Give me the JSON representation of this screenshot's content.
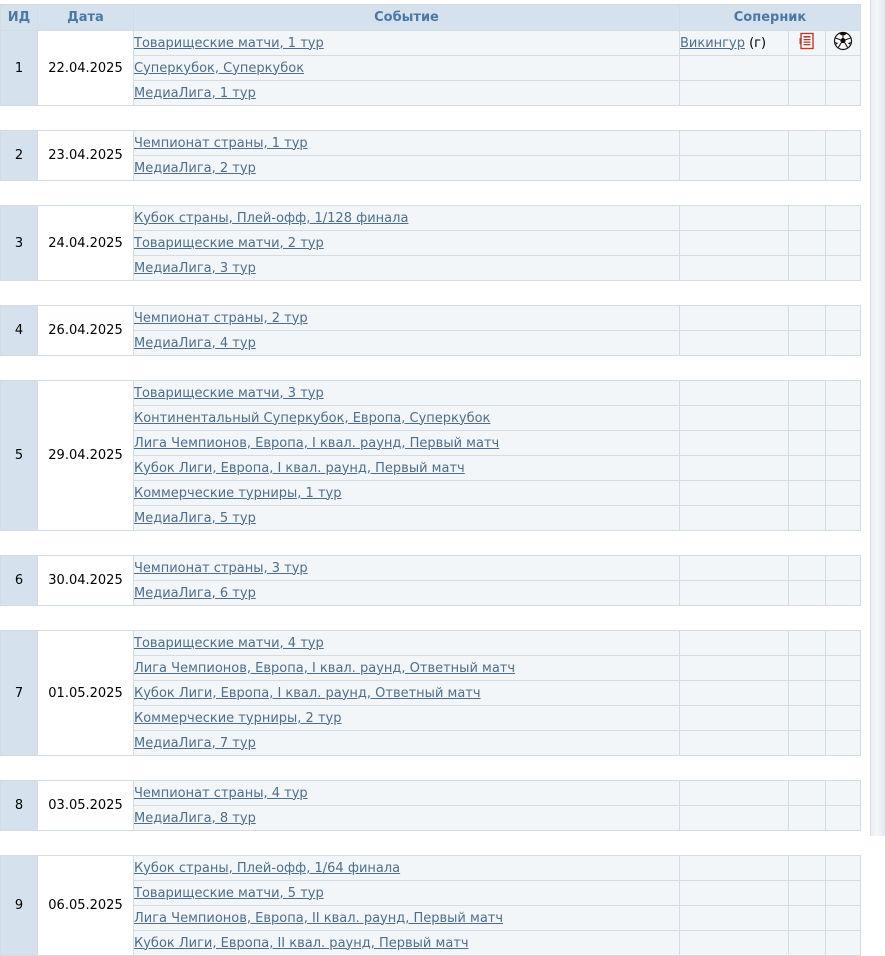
{
  "headers": {
    "id": "ИД",
    "date": "Дата",
    "event": "Событие",
    "opponent": "Соперник"
  },
  "days": [
    {
      "id": "1",
      "date": "22.04.2025",
      "events": [
        {
          "name": "Товарищеские матчи, 1 тур",
          "opponent": "Викингур",
          "venue": "(г)",
          "icons": [
            "report-icon",
            "ball-icon"
          ]
        },
        {
          "name": "Суперкубок, Суперкубок"
        },
        {
          "name": "МедиаЛига, 1 тур"
        }
      ]
    },
    {
      "id": "2",
      "date": "23.04.2025",
      "events": [
        {
          "name": "Чемпионат страны, 1 тур"
        },
        {
          "name": "МедиаЛига, 2 тур"
        }
      ]
    },
    {
      "id": "3",
      "date": "24.04.2025",
      "events": [
        {
          "name": "Кубок страны, Плей-офф, 1/128 финала"
        },
        {
          "name": "Товарищеские матчи, 2 тур"
        },
        {
          "name": "МедиаЛига, 3 тур"
        }
      ]
    },
    {
      "id": "4",
      "date": "26.04.2025",
      "events": [
        {
          "name": "Чемпионат страны, 2 тур"
        },
        {
          "name": "МедиаЛига, 4 тур"
        }
      ]
    },
    {
      "id": "5",
      "date": "29.04.2025",
      "events": [
        {
          "name": "Товарищеские матчи, 3 тур"
        },
        {
          "name": "Континентальный Суперкубок, Европа, Суперкубок"
        },
        {
          "name": "Лига Чемпионов, Европа, I квал. раунд, Первый матч"
        },
        {
          "name": "Кубок Лиги, Европа, I квал. раунд, Первый матч"
        },
        {
          "name": "Коммерческие турниры, 1 тур"
        },
        {
          "name": "МедиаЛига, 5 тур"
        }
      ]
    },
    {
      "id": "6",
      "date": "30.04.2025",
      "events": [
        {
          "name": "Чемпионат страны, 3 тур"
        },
        {
          "name": "МедиаЛига, 6 тур"
        }
      ]
    },
    {
      "id": "7",
      "date": "01.05.2025",
      "events": [
        {
          "name": "Товарищеские матчи, 4 тур"
        },
        {
          "name": "Лига Чемпионов, Европа, I квал. раунд, Ответный матч"
        },
        {
          "name": "Кубок Лиги, Европа, I квал. раунд, Ответный матч"
        },
        {
          "name": "Коммерческие турниры, 2 тур"
        },
        {
          "name": "МедиаЛига, 7 тур"
        }
      ]
    },
    {
      "id": "8",
      "date": "03.05.2025",
      "events": [
        {
          "name": "Чемпионат страны, 4 тур"
        },
        {
          "name": "МедиаЛига, 8 тур"
        }
      ]
    },
    {
      "id": "9",
      "date": "06.05.2025",
      "events": [
        {
          "name": "Кубок страны, Плей-офф, 1/64 финала"
        },
        {
          "name": "Товарищеские матчи, 5 тур"
        },
        {
          "name": "Лига Чемпионов, Европа, II квал. раунд, Первый матч"
        },
        {
          "name": "Кубок Лиги, Европа, II квал. раунд, Первый матч"
        }
      ]
    }
  ]
}
